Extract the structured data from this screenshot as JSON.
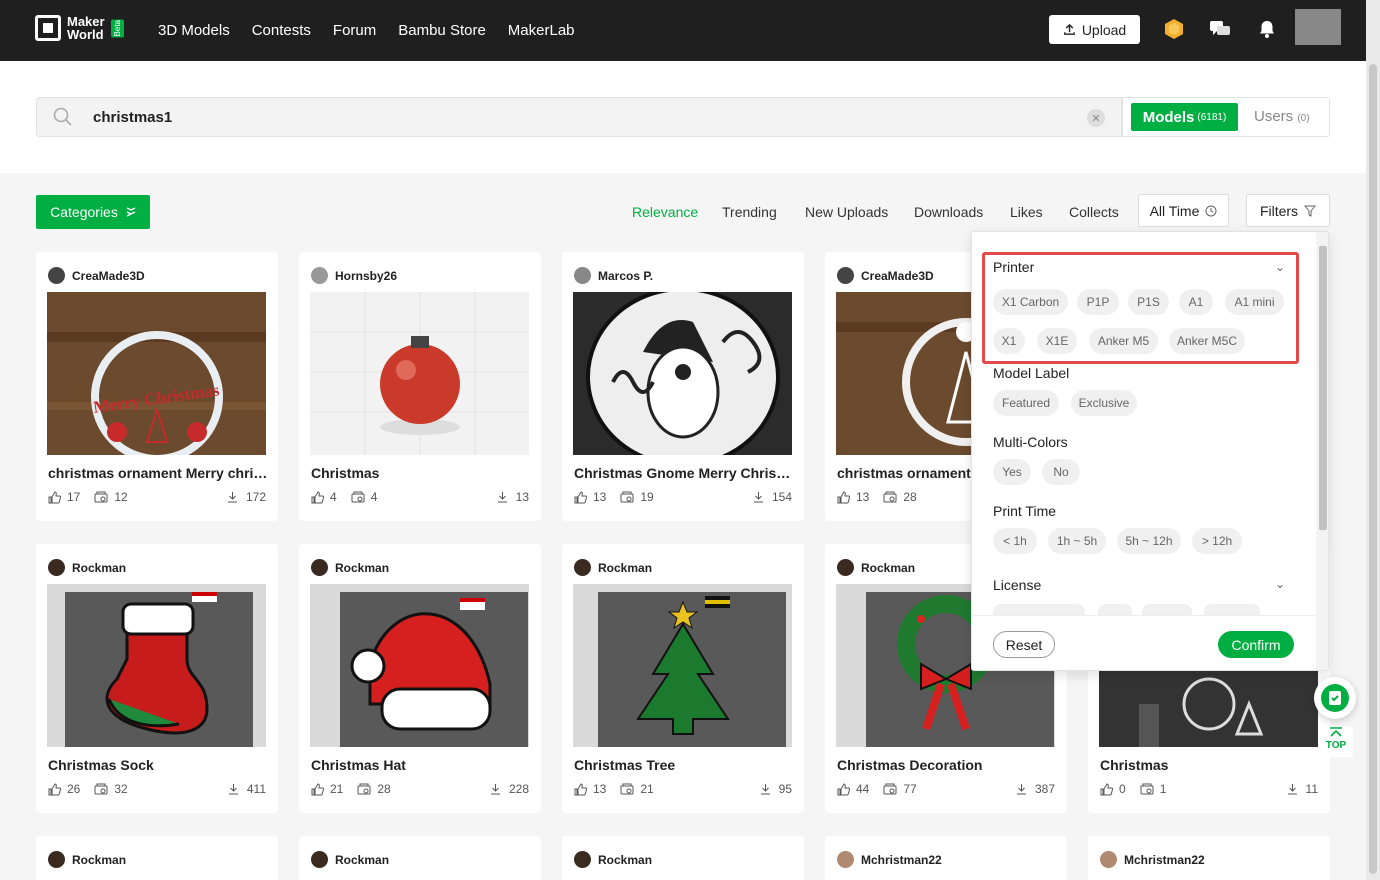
{
  "colors": {
    "accent": "#00ae42",
    "topbar": "#1f1f1f",
    "highlight": "#e14b4b"
  },
  "brand": {
    "line1": "Maker",
    "line2": "World",
    "beta": "Beta"
  },
  "nav": [
    "3D Models",
    "Contests",
    "Forum",
    "Bambu Store",
    "MakerLab"
  ],
  "header": {
    "upload_label": "Upload"
  },
  "search": {
    "query": "christmas1",
    "models_label": "Models",
    "models_count": "(6181)",
    "users_label": "Users",
    "users_count": "(0)"
  },
  "toolbar": {
    "categories_label": "Categories",
    "sorts": [
      "Relevance",
      "Trending",
      "New Uploads",
      "Downloads",
      "Likes",
      "Collects"
    ],
    "time_label": "All Time",
    "filters_label": "Filters"
  },
  "cards": [
    {
      "user": "CreaMade3D",
      "title": "christmas ornament Merry chris...",
      "likes": "17",
      "collects": "12",
      "downloads": "172"
    },
    {
      "user": "Hornsby26",
      "title": "Christmas",
      "likes": "4",
      "collects": "4",
      "downloads": "13"
    },
    {
      "user": "Marcos P.",
      "title": "Christmas Gnome Merry Christm...",
      "likes": "13",
      "collects": "19",
      "downloads": "154"
    },
    {
      "user": "CreaMade3D",
      "title": "christmas ornament r",
      "likes": "13",
      "collects": "28",
      "downloads": ""
    },
    {
      "user": "Rockman",
      "title": "Christmas Sock",
      "likes": "26",
      "collects": "32",
      "downloads": "411"
    },
    {
      "user": "Rockman",
      "title": "Christmas Hat",
      "likes": "21",
      "collects": "28",
      "downloads": "228"
    },
    {
      "user": "Rockman",
      "title": "Christmas Tree",
      "likes": "13",
      "collects": "21",
      "downloads": "95"
    },
    {
      "user": "Rockman",
      "title": "Christmas Decoration",
      "likes": "44",
      "collects": "77",
      "downloads": "387"
    },
    {
      "user": "",
      "title": "Christmas",
      "likes": "0",
      "collects": "1",
      "downloads": "11"
    }
  ],
  "bottom_row_users": [
    "Rockman",
    "Rockman",
    "Rockman",
    "Mchristman22",
    "Mchristman22"
  ],
  "filter_panel": {
    "printer": {
      "title": "Printer",
      "options": [
        "X1 Carbon",
        "P1P",
        "P1S",
        "A1",
        "A1 mini",
        "X1",
        "X1E",
        "Anker M5",
        "Anker M5C"
      ]
    },
    "model_label": {
      "title": "Model Label",
      "options": [
        "Featured",
        "Exclusive"
      ]
    },
    "multi_colors": {
      "title": "Multi-Colors",
      "options": [
        "Yes",
        "No"
      ]
    },
    "print_time": {
      "title": "Print Time",
      "options": [
        "< 1h",
        "1h ~ 5h",
        "5h ~ 12h",
        "> 12h"
      ]
    },
    "license": {
      "title": "License"
    },
    "reset_label": "Reset",
    "confirm_label": "Confirm"
  },
  "back_to_top": "TOP"
}
